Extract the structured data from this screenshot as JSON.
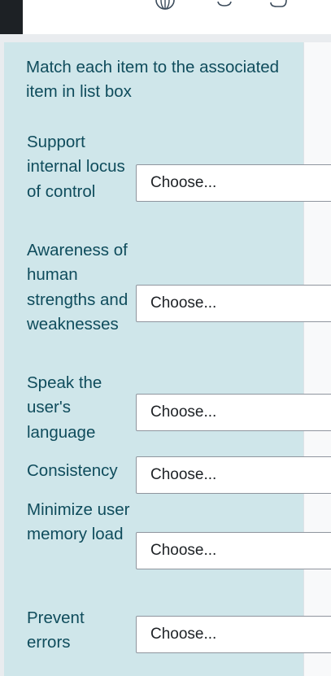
{
  "question": {
    "prompt": "Match each item to the associated item in list box",
    "items": [
      {
        "term": "Support internal locus of control",
        "selected": "Choose..."
      },
      {
        "term": "Awareness of human strengths and weaknesses",
        "selected": "Choose..."
      },
      {
        "term": "Speak the user's language",
        "selected": "Choose..."
      },
      {
        "term": "Consistency",
        "selected": "Choose..."
      },
      {
        "term": "Minimize user memory load",
        "selected": "Choose..."
      },
      {
        "term": "Prevent errors",
        "selected": "Choose..."
      }
    ]
  },
  "topbar": {
    "icons": [
      "globe-icon",
      "bell-icon",
      "chat-icon"
    ]
  },
  "colors": {
    "question_bg": "#cfe6ea",
    "text": "#0f4c5c"
  }
}
